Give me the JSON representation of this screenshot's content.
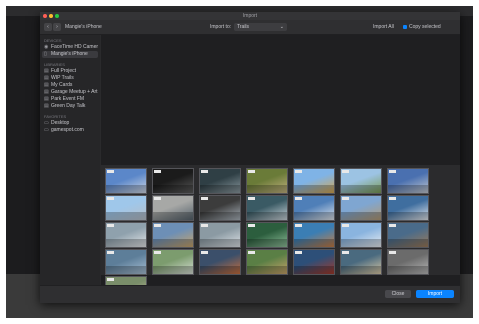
{
  "background_window": {
    "title": ""
  },
  "dialog": {
    "title": "Import",
    "toolbar": {
      "back_label": "‹",
      "forward_label": "›",
      "device_name": "Mangie's iPhone",
      "import_to_label": "Import to:",
      "import_to_value": "Trails",
      "import_all_label": "Import All",
      "checkbox_label": "Copy selected"
    },
    "sidebar": {
      "sections": [
        {
          "heading": "DEVICES",
          "items": [
            {
              "label": "FaceTime HD Camera (Built-in)",
              "icon": "camera-icon",
              "selected": false
            },
            {
              "label": "Mangie's iPhone",
              "icon": "phone-icon",
              "selected": true
            }
          ]
        },
        {
          "heading": "LIBRARIES",
          "items": [
            {
              "label": "Full Project",
              "icon": "library-icon",
              "selected": false
            },
            {
              "label": "WIP Trails",
              "icon": "library-icon",
              "selected": false
            },
            {
              "label": "My Cards",
              "icon": "library-icon",
              "selected": false
            },
            {
              "label": "Garage Meetup + Art",
              "icon": "library-icon",
              "selected": false
            },
            {
              "label": "Park Event FM",
              "icon": "library-icon",
              "selected": false
            },
            {
              "label": "Green Day Talk",
              "icon": "library-icon",
              "selected": false
            }
          ]
        },
        {
          "heading": "FAVORITES",
          "items": [
            {
              "label": "Desktop",
              "icon": "folder-icon",
              "selected": false
            },
            {
              "label": "gamespot.com",
              "icon": "folder-icon",
              "selected": false
            }
          ]
        }
      ]
    },
    "thumbnails": [
      {
        "colors": [
          "#5b87c9",
          "#cfd7e4"
        ]
      },
      {
        "colors": [
          "#1b1b1b",
          "#5a5a5a"
        ]
      },
      {
        "colors": [
          "#2f3f45",
          "#8b9aa0"
        ]
      },
      {
        "colors": [
          "#6a7b38",
          "#c4b380"
        ]
      },
      {
        "colors": [
          "#7fb3e6",
          "#d5a64f"
        ]
      },
      {
        "colors": [
          "#9cc3e3",
          "#7a9a52"
        ]
      },
      {
        "colors": [
          "#4a70b0",
          "#c2c8d0"
        ]
      },
      {
        "colors": [
          "#9fc7ea",
          "#b7bfc8"
        ]
      },
      {
        "colors": [
          "#a7a8a6",
          "#54616b"
        ]
      },
      {
        "colors": [
          "#3c3c3c",
          "#a9b2ba"
        ]
      },
      {
        "colors": [
          "#3a5a64",
          "#cbd5db"
        ]
      },
      {
        "colors": [
          "#4f7fb8",
          "#dfe4ea"
        ]
      },
      {
        "colors": [
          "#7fa6d1",
          "#b39a74"
        ]
      },
      {
        "colors": [
          "#3f6e9f",
          "#e1e5ea"
        ]
      },
      {
        "colors": [
          "#8fa1ad",
          "#e5e8ea"
        ]
      },
      {
        "colors": [
          "#6d8fb6",
          "#c7a36a"
        ]
      },
      {
        "colors": [
          "#8b9aa3",
          "#dfe4e8"
        ]
      },
      {
        "colors": [
          "#2c5e3e",
          "#8fbf9a"
        ]
      },
      {
        "colors": [
          "#3b7eb4",
          "#c67d43"
        ]
      },
      {
        "colors": [
          "#8ab4df",
          "#e9edf1"
        ]
      },
      {
        "colors": [
          "#4a6b8a",
          "#9b7a5a"
        ]
      },
      {
        "colors": [
          "#5d7e99",
          "#a9c1d6"
        ]
      },
      {
        "colors": [
          "#7c9c6e",
          "#d8e0d6"
        ]
      },
      {
        "colors": [
          "#3b4f6a",
          "#c86f3e"
        ]
      },
      {
        "colors": [
          "#5a7f45",
          "#c9a46a"
        ]
      },
      {
        "colors": [
          "#2d4f78",
          "#a33a2b"
        ]
      },
      {
        "colors": [
          "#4a6a7f",
          "#d9c9a6"
        ]
      },
      {
        "colors": [
          "#6b6b6b",
          "#b9b9b9"
        ]
      },
      {
        "colors": [
          "#7a8e6a",
          "#d0c1a0"
        ]
      }
    ],
    "buttons": {
      "stop_label": "Close",
      "import_selected_label": "Import"
    },
    "colors": {
      "accent": "#0a84ff",
      "close": "#ff5f57",
      "minimize": "#febc2e",
      "zoom": "#28c840"
    }
  }
}
